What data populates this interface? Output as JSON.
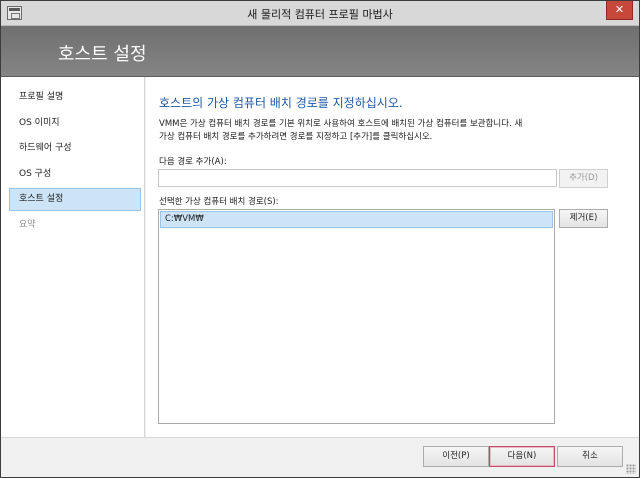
{
  "window": {
    "title": "새 물리적 컴퓨터 프로필 마법사",
    "close_label": "✕",
    "icon": "wizard-app-icon"
  },
  "banner": {
    "title": "호스트 설정"
  },
  "nav": {
    "items": [
      {
        "label": "프로필 설명",
        "state": "normal"
      },
      {
        "label": "OS 이미지",
        "state": "normal"
      },
      {
        "label": "하드웨어 구성",
        "state": "normal"
      },
      {
        "label": "OS 구성",
        "state": "normal"
      },
      {
        "label": "호스트 설정",
        "state": "active"
      },
      {
        "label": "요약",
        "state": "disabled"
      }
    ]
  },
  "main": {
    "heading": "호스트의 가상 컴퓨터 배치 경로를 지정하십시오.",
    "description_line1": "VMM은 가상 컴퓨터 배치 경로를 기본 위치로 사용하여 호스트에 배치된 가상 컴퓨터를 보관합니다. 새",
    "description_line2": "가상 컴퓨터 배치 경로를 추가하려면 경로를 지정하고 [추가]를 클릭하십시오.",
    "add_path_label": "다음 경로 추가(A):",
    "add_path_value": "",
    "add_button": "추가(D)",
    "selected_paths_label": "선택한 가상 컴퓨터 배치 경로(S):",
    "paths": [
      "C:₩VM₩"
    ],
    "remove_button": "제거(E)"
  },
  "footer": {
    "prev_button": "이전(P)",
    "next_button": "다음(N)",
    "cancel_button": "취소"
  },
  "colors": {
    "accent_heading": "#1f5aa6",
    "selection": "#cde4f7",
    "banner": "#7a7a7a",
    "close": "#c7473b"
  }
}
